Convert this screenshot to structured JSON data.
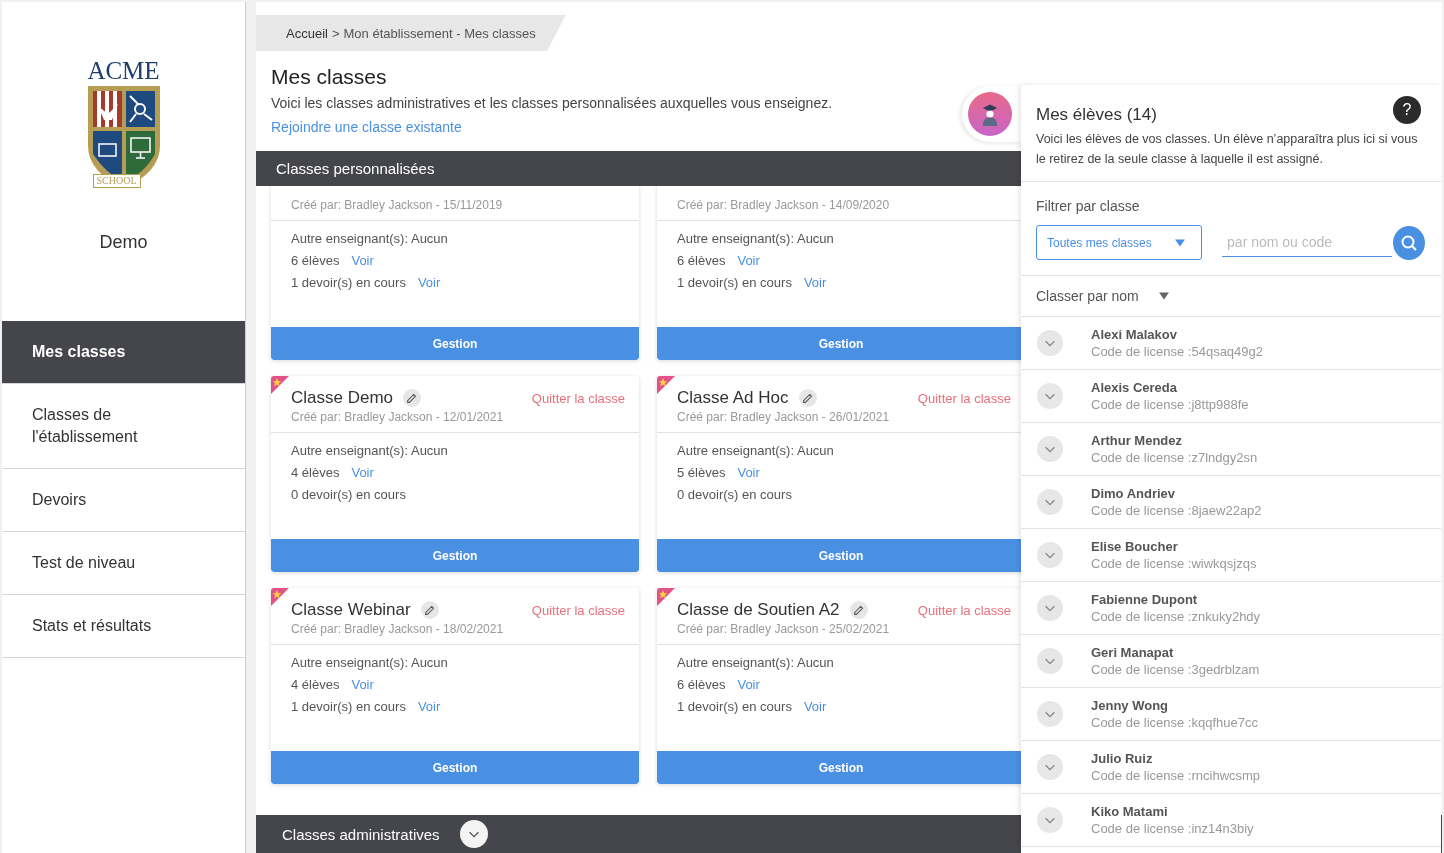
{
  "sidebar": {
    "logo": {
      "title": "ACME",
      "ribbon": "SCHOOL"
    },
    "school_name": "Demo",
    "items": [
      {
        "label": "Mes classes",
        "selected": true
      },
      {
        "label": "Classes de l'établissement",
        "selected": false
      },
      {
        "label": "Devoirs",
        "selected": false
      },
      {
        "label": "Test de niveau",
        "selected": false
      },
      {
        "label": "Stats et résultats",
        "selected": false
      }
    ]
  },
  "breadcrumb": {
    "home": "Accueil",
    "separator": ">",
    "current": "Mon établissement - Mes classes"
  },
  "page": {
    "title": "Mes classes",
    "description": "Voici les classes administratives et les classes personnalisées auxquelles vous enseignez.",
    "join_link": "Rejoindre une classe existante"
  },
  "custom_section": {
    "title": "Classes personnalisées",
    "cards": [
      {
        "creator": "Créé par: Bradley Jackson - 15/11/2019",
        "teachers": "Autre enseignant(s): Aucun",
        "students": "6 élèves",
        "students_link": "Voir",
        "assignments": "1 devoir(s) en cours",
        "assignments_link": "Voir",
        "button": "Gestion"
      },
      {
        "creator": "Créé par: Bradley Jackson - 14/09/2020",
        "teachers": "Autre enseignant(s): Aucun",
        "students": "6 élèves",
        "students_link": "Voir",
        "assignments": "1 devoir(s) en cours",
        "assignments_link": "Voir",
        "button": "Gestion"
      },
      {
        "title": "Classe Demo",
        "favorite": true,
        "leave": "Quitter la classe",
        "creator": "Créé par: Bradley Jackson - 12/01/2021",
        "teachers": "Autre enseignant(s): Aucun",
        "students": "4 élèves",
        "students_link": "Voir",
        "assignments": "0 devoir(s) en cours",
        "button": "Gestion"
      },
      {
        "title": "Classe Ad Hoc",
        "favorite": true,
        "leave": "Quitter la classe",
        "creator": "Créé par: Bradley Jackson - 26/01/2021",
        "teachers": "Autre enseignant(s): Aucun",
        "students": "5 élèves",
        "students_link": "Voir",
        "assignments": "0 devoir(s) en cours",
        "button": "Gestion"
      },
      {
        "title": "Classe Webinar",
        "favorite": true,
        "leave": "Quitter la classe",
        "creator": "Créé par: Bradley Jackson - 18/02/2021",
        "teachers": "Autre enseignant(s): Aucun",
        "students": "4 élèves",
        "students_link": "Voir",
        "assignments": "1 devoir(s) en cours",
        "assignments_link": "Voir",
        "button": "Gestion"
      },
      {
        "title": "Classe de Soutien A2",
        "favorite": true,
        "leave": "Quitter la classe",
        "creator": "Créé par: Bradley Jackson - 25/02/2021",
        "teachers": "Autre enseignant(s): Aucun",
        "students": "6 élèves",
        "students_link": "Voir",
        "assignments": "1 devoir(s) en cours",
        "assignments_link": "Voir",
        "button": "Gestion"
      }
    ]
  },
  "admin_section": {
    "title": "Classes administratives",
    "expanded": false
  },
  "students_panel": {
    "title": "Mes élèves (14)",
    "help": "?",
    "description": "Voici les élèves de vos classes. Un élève n’apparaîtra plus ici si vous le retirez de la seule classe à laquelle il est assigné.",
    "filter_label": "Filtrer par classe",
    "filter_value": "Toutes mes classes",
    "search_placeholder": "par nom ou code",
    "sort_label": "Classer par nom",
    "students": [
      {
        "name": "Alexi Malakov",
        "code": "Code de license :54qsaq49g2"
      },
      {
        "name": "Alexis Cereda",
        "code": "Code de license :j8ttp988fe"
      },
      {
        "name": "Arthur Mendez",
        "code": "Code de license :z7lndgy2sn"
      },
      {
        "name": "Dimo Andriev",
        "code": "Code de license :8jaew22ap2"
      },
      {
        "name": "Elise Boucher",
        "code": "Code de license :wiwkqsjzqs"
      },
      {
        "name": "Fabienne Dupont",
        "code": "Code de license :znkuky2hdy"
      },
      {
        "name": "Geri Manapat",
        "code": "Code de license :3gedrblzam"
      },
      {
        "name": "Jenny Wong",
        "code": "Code de license :kqqfhue7cc"
      },
      {
        "name": "Julio Ruiz",
        "code": "Code de license :rncihwcsmp"
      },
      {
        "name": "Kiko Matami",
        "code": "Code de license :inz14n3biy"
      }
    ]
  }
}
